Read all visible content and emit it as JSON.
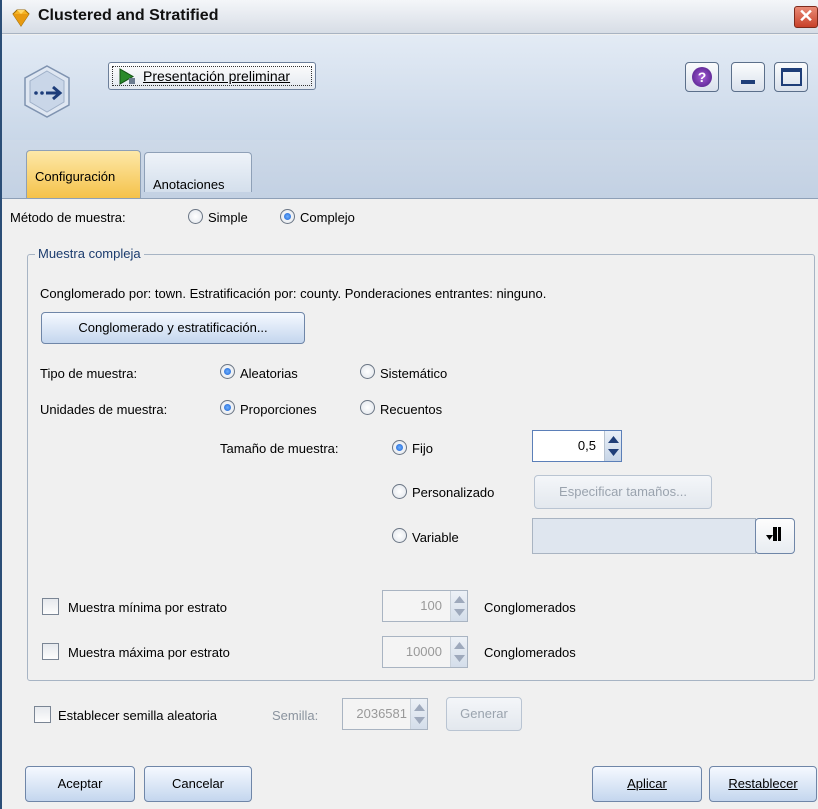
{
  "window": {
    "title": "Clustered and Stratified",
    "close_glyph": "✕",
    "icon": "sample-node-gem-icon"
  },
  "toolbar": {
    "preview_label": "Presentación preliminar",
    "help_glyph": "?",
    "help_icon": "help-icon",
    "min_icon": "minimize-icon",
    "max_icon": "maximize-icon"
  },
  "tabs": [
    {
      "label": "Configuración",
      "active": true
    },
    {
      "label": "Anotaciones",
      "active": false
    }
  ],
  "method": {
    "label": "Método de muestra:",
    "options": [
      {
        "label": "Simple",
        "selected": false
      },
      {
        "label": "Complejo",
        "selected": true
      }
    ]
  },
  "complex": {
    "legend": "Muestra compleja",
    "summary": "Conglomerado por: town. Estratificación por: county. Ponderaciones entrantes: ninguno.",
    "cluster_button": "Conglomerado y estratificación...",
    "sample_type": {
      "label": "Tipo de muestra:",
      "options": [
        {
          "label": "Aleatorias",
          "selected": true
        },
        {
          "label": "Sistemático",
          "selected": false
        }
      ]
    },
    "sample_units": {
      "label": "Unidades de muestra:",
      "options": [
        {
          "label": "Proporciones",
          "selected": true
        },
        {
          "label": "Recuentos",
          "selected": false
        }
      ]
    },
    "sample_size": {
      "label": "Tamaño de muestra:",
      "fixed_label": "Fijo",
      "fixed_value": "0,5",
      "custom_label": "Personalizado",
      "specify_button": "Especificar tamaños...",
      "variable_label": "Variable",
      "variable_value": ""
    },
    "min_per_stratum": {
      "label": "Muestra mínima por estrato",
      "value": "100",
      "unit": "Conglomerados",
      "checked": false
    },
    "max_per_stratum": {
      "label": "Muestra máxima por estrato",
      "value": "10000",
      "unit": "Conglomerados",
      "checked": false
    }
  },
  "seed": {
    "label": "Establecer semilla aleatoria",
    "seed_label": "Semilla:",
    "seed_value": "2036581",
    "generate_button": "Generar",
    "checked": false
  },
  "footer": {
    "ok": "Aceptar",
    "cancel": "Cancelar",
    "apply": "Aplicar",
    "reset": "Restablecer"
  },
  "colors": {
    "active_tab": "#f5c24a",
    "toolbar_bg": "#c9d7e8",
    "close": "#c8412a",
    "radio_on": "#1a5fd0"
  }
}
